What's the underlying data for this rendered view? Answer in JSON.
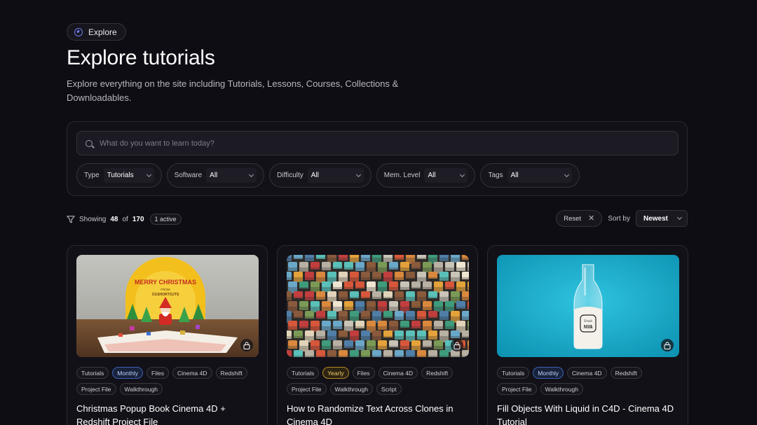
{
  "badge": {
    "label": "Explore",
    "icon": "compass-icon"
  },
  "page": {
    "title": "Explore tutorials",
    "subtitle": "Explore everything on the site including Tutorials, Lessons, Courses, Collections & Downloadables."
  },
  "search": {
    "placeholder": "What do you want to learn today?",
    "value": ""
  },
  "filters": [
    {
      "label": "Type",
      "value": "Tutorials"
    },
    {
      "label": "Software",
      "value": "All"
    },
    {
      "label": "Difficulty",
      "value": "All"
    },
    {
      "label": "Mem. Level",
      "value": "All"
    },
    {
      "label": "Tags",
      "value": "All"
    }
  ],
  "results": {
    "showing_prefix": "Showing",
    "shown": "48",
    "of": "of",
    "total": "170",
    "active": "1 active"
  },
  "sort": {
    "reset_label": "Reset",
    "sort_by_label": "Sort by",
    "value": "Newest"
  },
  "cards": [
    {
      "tags": [
        "Tutorials",
        "Monthly",
        "Files",
        "Cinema 4D",
        "Redshift",
        "Project File",
        "Walkthrough"
      ],
      "title": "Christmas Popup Book Cinema 4D + Redshift Project File",
      "locked": true
    },
    {
      "tags": [
        "Tutorials",
        "Yearly",
        "Files",
        "Cinema 4D",
        "Redshift",
        "Project File",
        "Walkthrough",
        "Script"
      ],
      "title": "How to Randomize Text Across Clones in Cinema 4D",
      "locked": true
    },
    {
      "tags": [
        "Tutorials",
        "Monthly",
        "Cinema 4D",
        "Redshift",
        "Project File",
        "Walkthrough"
      ],
      "title": "Fill Objects With Liquid in C4D - Cinema 4D Tutorial",
      "locked": true
    }
  ],
  "thumb_text": {
    "card1": {
      "line1": "MERRY CHRISTMAS",
      "line2": "FROM",
      "line3": "CGSHORTCUTS"
    },
    "card3": {
      "line1": "Fresh",
      "line2": "Milk"
    }
  },
  "colors": {
    "accent": "#6f7bf0",
    "monthly": "#3e61b3",
    "yearly": "#b48a26",
    "background": "#0e0d14"
  }
}
